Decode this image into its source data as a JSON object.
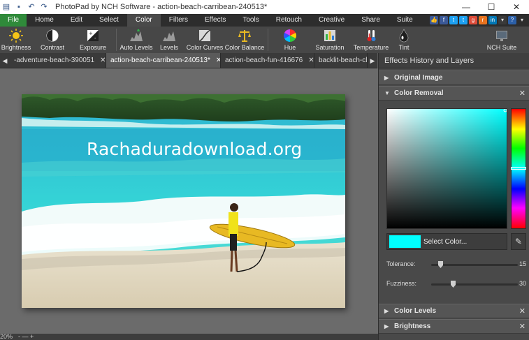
{
  "window": {
    "title": "PhotoPad by NCH Software - action-beach-carribean-240513*",
    "controls": [
      "—",
      "☐",
      "✕"
    ]
  },
  "menu": {
    "tabs": [
      "File",
      "Home",
      "Edit",
      "Select",
      "Color",
      "Filters",
      "Effects",
      "Tools",
      "Retouch",
      "Creative",
      "Share",
      "Suite"
    ],
    "active": "Color"
  },
  "ribbon": {
    "buttons": [
      {
        "label": "Brightness",
        "icon": "sun-icon"
      },
      {
        "label": "Contrast",
        "icon": "contrast-icon"
      },
      {
        "label": "Exposure",
        "icon": "exposure-icon"
      },
      {
        "label": "Auto Levels",
        "icon": "auto-levels-icon"
      },
      {
        "label": "Levels",
        "icon": "levels-icon"
      },
      {
        "label": "Color Curves",
        "icon": "curves-icon"
      },
      {
        "label": "Color Balance",
        "icon": "balance-icon"
      },
      {
        "label": "Hue",
        "icon": "hue-wheel-icon"
      },
      {
        "label": "Saturation",
        "icon": "saturation-icon"
      },
      {
        "label": "Temperature",
        "icon": "thermometer-icon"
      },
      {
        "label": "Tint",
        "icon": "tint-drop-icon"
      },
      {
        "label": "NCH Suite",
        "icon": "suite-icon"
      }
    ]
  },
  "doc_tabs": [
    {
      "label": "-adventure-beach-390051",
      "active": false
    },
    {
      "label": "action-beach-carribean-240513*",
      "active": true
    },
    {
      "label": "action-beach-fun-416676",
      "active": false
    },
    {
      "label": "backlit-beach-cl",
      "active": false
    }
  ],
  "canvas": {
    "watermark": "Rachaduradownload.org"
  },
  "status": {
    "zoom": "20%",
    "zoom_controls": "- — +"
  },
  "panel": {
    "header": "Effects History and Layers",
    "sections": {
      "original_image": "Original Image",
      "color_removal": "Color Removal",
      "color_levels": "Color Levels",
      "brightness": "Brightness"
    },
    "select_color_label": "Select Color...",
    "selected_color": "#00ffff",
    "tolerance": {
      "label": "Tolerance:",
      "value": "15"
    },
    "fuzziness": {
      "label": "Fuzziness:",
      "value": "30"
    }
  }
}
